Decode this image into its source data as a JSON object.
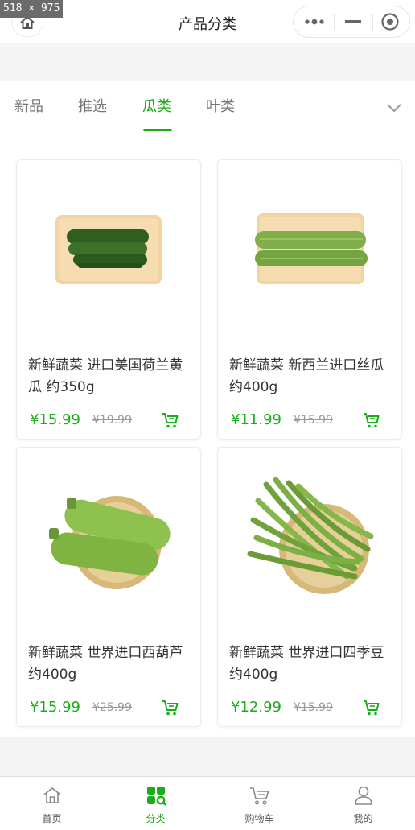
{
  "badge": {
    "dimensions": "518 × 975"
  },
  "header": {
    "title": "产品分类"
  },
  "tabs": [
    {
      "label": "新品"
    },
    {
      "label": "推选"
    },
    {
      "label": "瓜类",
      "active": true
    },
    {
      "label": "叶类"
    }
  ],
  "products": [
    {
      "name": "新鲜蔬菜 进口美国荷兰黄 瓜 约350g",
      "price": "¥15.99",
      "old_price": "¥19.99",
      "image": "cucumber-on-board"
    },
    {
      "name": "新鲜蔬菜 新西兰进口丝瓜 约400g",
      "price": "¥11.99",
      "old_price": "¥15.99",
      "image": "loofah-on-board"
    },
    {
      "name": "新鲜蔬菜 世界进口西葫芦 约400g",
      "price": "¥15.99",
      "old_price": "¥25.99",
      "image": "zucchini-in-basket"
    },
    {
      "name": "新鲜蔬菜 世界进口四季豆 约400g",
      "price": "¥12.99",
      "old_price": "¥15.99",
      "image": "green-beans-in-basket"
    }
  ],
  "tabbar": [
    {
      "label": "首页",
      "icon": "home-icon"
    },
    {
      "label": "分类",
      "icon": "category-icon",
      "active": true
    },
    {
      "label": "购物车",
      "icon": "cart-icon"
    },
    {
      "label": "我的",
      "icon": "user-icon"
    }
  ],
  "colors": {
    "accent": "#1aad19",
    "text": "#333333",
    "muted": "#999999",
    "background": "#f4f4f4"
  }
}
